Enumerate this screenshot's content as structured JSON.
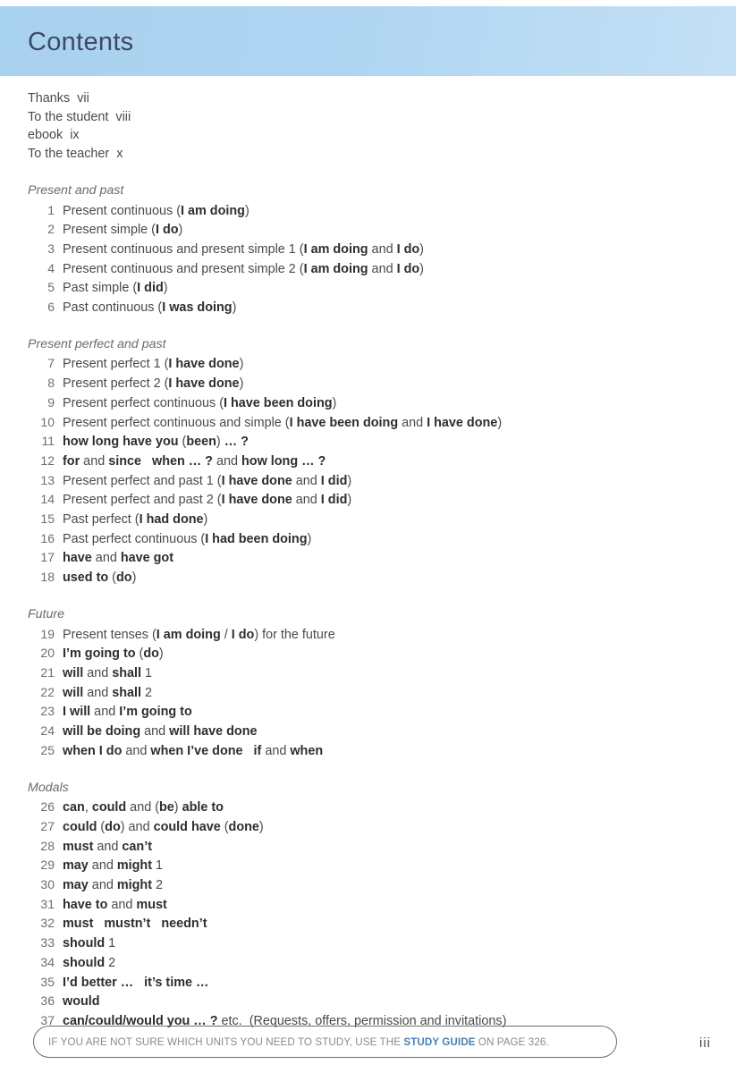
{
  "header": {
    "title": "Contents",
    "band_color": "#aed4f1",
    "title_color": "#3c4a63"
  },
  "front_matter": [
    "Thanks  vii",
    "To the student  viii",
    "ebook  ix",
    "To the teacher  x"
  ],
  "sections": [
    {
      "title": "Present and past",
      "entries": [
        {
          "num": "1",
          "html": "Present continuous (<b>I am doing</b>)"
        },
        {
          "num": "2",
          "html": "Present simple (<b>I do</b>)"
        },
        {
          "num": "3",
          "html": "Present continuous and present simple 1 (<b>I am doing</b> and <b>I do</b>)"
        },
        {
          "num": "4",
          "html": "Present continuous and present simple 2 (<b>I am doing</b> and <b>I do</b>)"
        },
        {
          "num": "5",
          "html": "Past simple (<b>I did</b>)"
        },
        {
          "num": "6",
          "html": "Past continuous (<b>I was doing</b>)"
        }
      ]
    },
    {
      "title": "Present perfect and past",
      "entries": [
        {
          "num": "7",
          "html": "Present perfect 1 (<b>I have done</b>)"
        },
        {
          "num": "8",
          "html": "Present perfect 2 (<b>I have done</b>)"
        },
        {
          "num": "9",
          "html": "Present perfect continuous (<b>I have been doing</b>)"
        },
        {
          "num": "10",
          "html": "Present perfect continuous and simple (<b>I have been doing</b> and <b>I have done</b>)"
        },
        {
          "num": "11",
          "html": "<b>how long have you</b> (<b>been</b>) <b>… ?</b>"
        },
        {
          "num": "12",
          "html": "<b>for</b> and <b>since</b>   <b>when … ?</b> and <b>how long … ?</b>"
        },
        {
          "num": "13",
          "html": "Present perfect and past 1 (<b>I have done</b> and <b>I did</b>)"
        },
        {
          "num": "14",
          "html": "Present perfect and past 2 (<b>I have done</b> and <b>I did</b>)"
        },
        {
          "num": "15",
          "html": "Past perfect (<b>I had done</b>)"
        },
        {
          "num": "16",
          "html": "Past perfect continuous (<b>I had been doing</b>)"
        },
        {
          "num": "17",
          "html": "<b>have</b> and <b>have got</b>"
        },
        {
          "num": "18",
          "html": "<b>used to</b> (<b>do</b>)"
        }
      ]
    },
    {
      "title": "Future",
      "entries": [
        {
          "num": "19",
          "html": "Present tenses (<b>I am doing</b> / <b>I do</b>) for the future"
        },
        {
          "num": "20",
          "html": "<b>I’m going to</b> (<b>do</b>)"
        },
        {
          "num": "21",
          "html": "<b>will</b> and <b>shall</b> 1"
        },
        {
          "num": "22",
          "html": "<b>will</b> and <b>shall</b> 2"
        },
        {
          "num": "23",
          "html": "<b>I will</b> and <b>I’m going to</b>"
        },
        {
          "num": "24",
          "html": "<b>will be doing</b> and <b>will have done</b>"
        },
        {
          "num": "25",
          "html": "<b>when I do</b> and <b>when I’ve done</b>   <b>if</b> and <b>when</b>"
        }
      ]
    },
    {
      "title": "Modals",
      "entries": [
        {
          "num": "26",
          "html": "<b>can</b>, <b>could</b> and (<b>be</b>) <b>able to</b>"
        },
        {
          "num": "27",
          "html": "<b>could</b> (<b>do</b>) and <b>could have</b> (<b>done</b>)"
        },
        {
          "num": "28",
          "html": "<b>must</b> and <b>can’t</b>"
        },
        {
          "num": "29",
          "html": "<b>may</b> and <b>might</b> 1"
        },
        {
          "num": "30",
          "html": "<b>may</b> and <b>might</b> 2"
        },
        {
          "num": "31",
          "html": "<b>have to</b> and <b>must</b>"
        },
        {
          "num": "32",
          "html": "<b>must   mustn’t   needn’t</b>"
        },
        {
          "num": "33",
          "html": "<b>should</b> 1"
        },
        {
          "num": "34",
          "html": "<b>should</b> 2"
        },
        {
          "num": "35",
          "html": "<b>I’d better …   it’s time …</b>"
        },
        {
          "num": "36",
          "html": "<b>would</b>"
        },
        {
          "num": "37",
          "html": "<b>can/could/would you … ?</b> etc.  (Requests, offers, permission and invitations)"
        }
      ]
    }
  ],
  "footer": {
    "note_html": "IF YOU ARE NOT SURE WHICH UNITS YOU NEED TO STUDY, USE THE <b>STUDY GUIDE</b> ON PAGE 326.",
    "accent_color": "#4a7fb5",
    "page_number": "iii"
  }
}
